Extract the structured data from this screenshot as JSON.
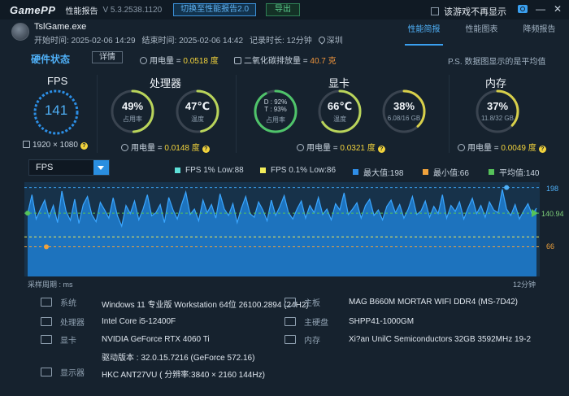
{
  "titlebar": {
    "logo": "GamePP",
    "title": "性能报告",
    "version": "V 5.3.2538.1120",
    "switch_label": "切换至性能报告2.0",
    "export_label": "导出",
    "no_show_label": "该游戏不再显示",
    "min_glyph": "—",
    "close_glyph": "✕"
  },
  "game": {
    "name": "TslGame.exe",
    "start": "开始时间: 2025-02-06 14:29",
    "end": "结束时间: 2025-02-06 14:42",
    "duration": "记录时长: 12分钟",
    "location": "深圳"
  },
  "tabs": [
    {
      "label": "性能简报",
      "active": true
    },
    {
      "label": "性能图表",
      "active": false
    },
    {
      "label": "降频报告",
      "active": false
    }
  ],
  "hardware": {
    "title": "硬件状态",
    "detail_label": "详情",
    "power_label": "用电量 = ",
    "power_value": "0.0518 度",
    "co2_label": "二氧化碳排放量 = ",
    "co2_value": "40.7 克",
    "note": "P.S. 数据图显示的是平均值"
  },
  "fps": {
    "label": "FPS",
    "value": "141",
    "resolution": "1920 × 1080"
  },
  "cpu": {
    "label": "处理器",
    "usage_value": "49%",
    "usage_sub": "占用率",
    "usage_level": 0.49,
    "temp_value": "47℃",
    "temp_sub": "温度",
    "temp_level": 0.47,
    "power_label": "用电量 = ",
    "power_value": "0.0148 度"
  },
  "gpu": {
    "label": "显卡",
    "d_line": "D : 92%",
    "t_line": "T : 93%",
    "usage_sub": "占用率",
    "usage_level": 0.92,
    "temp_value": "66℃",
    "temp_sub": "温度",
    "temp_level": 0.66,
    "vram_value": "38%",
    "vram_sub": "6.08/16 GB",
    "vram_level": 0.38,
    "power_label": "用电量 = ",
    "power_value": "0.0321 度"
  },
  "memory": {
    "label": "内存",
    "value": "37%",
    "sub": "11.8/32 GB",
    "level": 0.37,
    "power_label": "用电量 = ",
    "power_value": "0.0049 度"
  },
  "chart": {
    "metric_select": "FPS",
    "legend": [
      {
        "label": "FPS 1% Low:88",
        "color": "#5ee0d8"
      },
      {
        "label": "FPS 0.1% Low:86",
        "color": "#f2ec5a"
      },
      {
        "label": "最大值:198",
        "color": "#2f8ee8"
      },
      {
        "label": "最小值:66",
        "color": "#f0a23c"
      },
      {
        "label": "平均值:140",
        "color": "#56c25a"
      }
    ],
    "period_label": "采样周期 : ms",
    "span_label": "12分钟",
    "max_label": "198",
    "avg_label": "140.94",
    "min_label": "66"
  },
  "chart_data": {
    "type": "area",
    "ylim": [
      0,
      210
    ],
    "max": 198,
    "min": 66,
    "avg": 140.94,
    "low_1pct": 88,
    "low_01pct": 86,
    "values": [
      140,
      182,
      128,
      150,
      170,
      132,
      158,
      120,
      190,
      145,
      125,
      172,
      118,
      160,
      178,
      138,
      122,
      165,
      148,
      130,
      175,
      135,
      112,
      158,
      140,
      168,
      126,
      150,
      182,
      135,
      142,
      160,
      120,
      176,
      148,
      128,
      160,
      188,
      138,
      150,
      124,
      170,
      142,
      160,
      130,
      184,
      150,
      136,
      162,
      120,
      152,
      178,
      140,
      132,
      166,
      148,
      124,
      170,
      136,
      156,
      180,
      142,
      128,
      150,
      168,
      130,
      158,
      142,
      176,
      138,
      150,
      126,
      162,
      148,
      186,
      138,
      150,
      164,
      130,
      158,
      172,
      136,
      148,
      126,
      156,
      170,
      142,
      160,
      130,
      150,
      178,
      138,
      146,
      168,
      132,
      156,
      140,
      182,
      130,
      158,
      145,
      166,
      128,
      152,
      174,
      140,
      158,
      132,
      166,
      148,
      142,
      194,
      150,
      136,
      160,
      128,
      146,
      162,
      138,
      152
    ]
  },
  "system": {
    "os_key": "系统",
    "os_val": "Windows 11 专业版 Workstation 64位 26100.2894 (24H2)",
    "mb_key": "主板",
    "mb_val": "MAG B660M MORTAR WIFI DDR4 (MS-7D42)",
    "cpu_key": "处理器",
    "cpu_val": "Intel Core i5-12400F",
    "disk_key": "主硬盘",
    "disk_val": "SHPP41-1000GM",
    "gpu_key": "显卡",
    "gpu_val": "NVIDIA GeForce RTX 4060 Ti",
    "mem_key": "内存",
    "mem_val": "Xi?an UnilC Semiconductors 32GB 3592MHz 19-2",
    "driver_val": "驱动版本 : 32.0.15.7216 (GeForce 572.16)",
    "display_key": "显示器",
    "display_val": "HKC ANT27VU ( 分辨率:3840 × 2160 144Hz)"
  }
}
